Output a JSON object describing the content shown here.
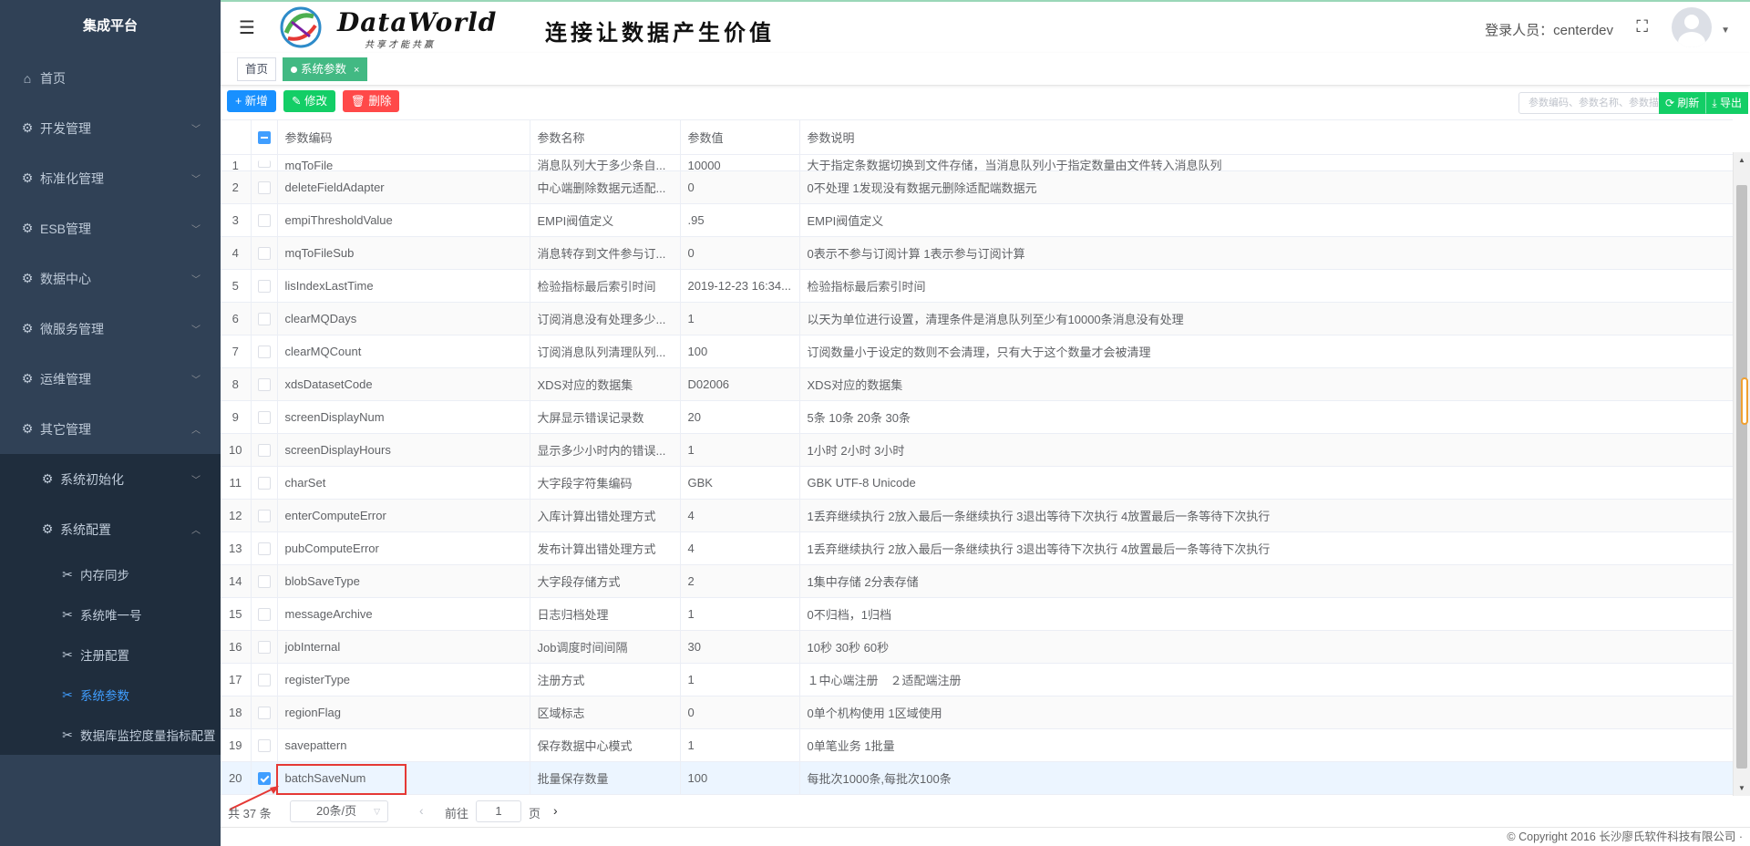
{
  "sidebar": {
    "title": "集成平台",
    "items": [
      {
        "label": "首页",
        "icon": "home-icon"
      },
      {
        "label": "开发管理",
        "icon": "gear-icon"
      },
      {
        "label": "标准化管理",
        "icon": "gear-icon"
      },
      {
        "label": "ESB管理",
        "icon": "gear-icon"
      },
      {
        "label": "数据中心",
        "icon": "gear-icon"
      },
      {
        "label": "微服务管理",
        "icon": "gear-icon"
      },
      {
        "label": "运维管理",
        "icon": "gear-icon"
      },
      {
        "label": "其它管理",
        "icon": "gear-icon"
      }
    ],
    "sub_items": [
      {
        "label": "系统初始化",
        "icon": "gear-icon"
      },
      {
        "label": "系统配置",
        "icon": "gear-icon"
      }
    ],
    "leaf_items": [
      {
        "label": "内存同步",
        "icon": "tools-icon"
      },
      {
        "label": "系统唯一号",
        "icon": "tools-icon"
      },
      {
        "label": "注册配置",
        "icon": "tools-icon"
      },
      {
        "label": "系统参数",
        "icon": "tools-icon",
        "active": true
      },
      {
        "label": "数据库监控度量指标配置",
        "icon": "tools-icon"
      }
    ]
  },
  "header": {
    "logo_text": "DataWorld",
    "logo_sub": "共享才能共赢",
    "slogan": "连接让数据产生价值",
    "login_label": "登录人员：centerdev"
  },
  "tags": {
    "home": "首页",
    "current": "系统参数",
    "close": "×"
  },
  "toolbar": {
    "add": "+ 新增",
    "edit": "✎ 修改",
    "delete": "🗑 删除",
    "search_placeholder": "参数编码、参数名称、参数描",
    "refresh": "⟳ 刷新",
    "export": "⤓ 导出"
  },
  "table": {
    "headers": [
      "",
      "",
      "参数编码",
      "参数名称",
      "参数值",
      "参数说明"
    ],
    "partial_row": {
      "num": "1",
      "code": "mqToFile",
      "name": "消息队列大于多少条自...",
      "value": "10000",
      "desc": "大于指定条数据切换到文件存储，当消息队列小于指定数量由文件转入消息队列"
    },
    "rows": [
      {
        "num": "2",
        "code": "deleteFieldAdapter",
        "name": "中心端删除数据元适配...",
        "value": "0",
        "desc": "0不处理 1发现没有数据元删除适配端数据元",
        "checked": false
      },
      {
        "num": "3",
        "code": "empiThresholdValue",
        "name": "EMPI阀值定义",
        "value": ".95",
        "desc": "EMPI阀值定义",
        "checked": false
      },
      {
        "num": "4",
        "code": "mqToFileSub",
        "name": "消息转存到文件参与订...",
        "value": "0",
        "desc": "0表示不参与订阅计算 1表示参与订阅计算",
        "checked": false
      },
      {
        "num": "5",
        "code": "lisIndexLastTime",
        "name": "检验指标最后索引时间",
        "value": "2019-12-23 16:34...",
        "desc": "检验指标最后索引时间",
        "checked": false
      },
      {
        "num": "6",
        "code": "clearMQDays",
        "name": "订阅消息没有处理多少...",
        "value": "1",
        "desc": "以天为单位进行设置，清理条件是消息队列至少有10000条消息没有处理",
        "checked": false
      },
      {
        "num": "7",
        "code": "clearMQCount",
        "name": "订阅消息队列清理队列...",
        "value": "100",
        "desc": "订阅数量小于设定的数则不会清理，只有大于这个数量才会被清理",
        "checked": false
      },
      {
        "num": "8",
        "code": "xdsDatasetCode",
        "name": "XDS对应的数据集",
        "value": "D02006",
        "desc": "XDS对应的数据集",
        "checked": false
      },
      {
        "num": "9",
        "code": "screenDisplayNum",
        "name": "大屏显示错误记录数",
        "value": "20",
        "desc": "5条 10条 20条 30条",
        "checked": false
      },
      {
        "num": "10",
        "code": "screenDisplayHours",
        "name": "显示多少小时内的错误...",
        "value": "1",
        "desc": "1小时 2小时 3小时",
        "checked": false
      },
      {
        "num": "11",
        "code": "charSet",
        "name": "大字段字符集编码",
        "value": "GBK",
        "desc": "GBK UTF-8 Unicode",
        "checked": false
      },
      {
        "num": "12",
        "code": "enterComputeError",
        "name": "入库计算出错处理方式",
        "value": "4",
        "desc": "1丢弃继续执行 2放入最后一条继续执行 3退出等待下次执行 4放置最后一条等待下次执行",
        "checked": false
      },
      {
        "num": "13",
        "code": "pubComputeError",
        "name": "发布计算出错处理方式",
        "value": "4",
        "desc": "1丢弃继续执行 2放入最后一条继续执行 3退出等待下次执行 4放置最后一条等待下次执行",
        "checked": false
      },
      {
        "num": "14",
        "code": "blobSaveType",
        "name": "大字段存储方式",
        "value": "2",
        "desc": "1集中存储 2分表存储",
        "checked": false
      },
      {
        "num": "15",
        "code": "messageArchive",
        "name": "日志归档处理",
        "value": "1",
        "desc": "0不归档，1归档",
        "checked": false
      },
      {
        "num": "16",
        "code": "jobInternal",
        "name": "Job调度时间间隔",
        "value": "30",
        "desc": "10秒    30秒    60秒",
        "checked": false
      },
      {
        "num": "17",
        "code": "registerType",
        "name": "注册方式",
        "value": "1",
        "desc": "１中心端注册　２适配端注册",
        "checked": false
      },
      {
        "num": "18",
        "code": "regionFlag",
        "name": "区域标志",
        "value": "0",
        "desc": "0单个机构使用 1区域使用",
        "checked": false
      },
      {
        "num": "19",
        "code": "savepattern",
        "name": "保存数据中心模式",
        "value": "1",
        "desc": "0单笔业务 1批量",
        "checked": false
      },
      {
        "num": "20",
        "code": "batchSaveNum",
        "name": "批量保存数量",
        "value": "100",
        "desc": "每批次1000条,每批次100条",
        "checked": true
      }
    ]
  },
  "pager": {
    "total": "共 37 条",
    "size": "20条/页",
    "goto": "前往",
    "page": "1",
    "page_unit": "页"
  },
  "footer": "© Copyright 2016 长沙廖氏软件科技有限公司 ·"
}
